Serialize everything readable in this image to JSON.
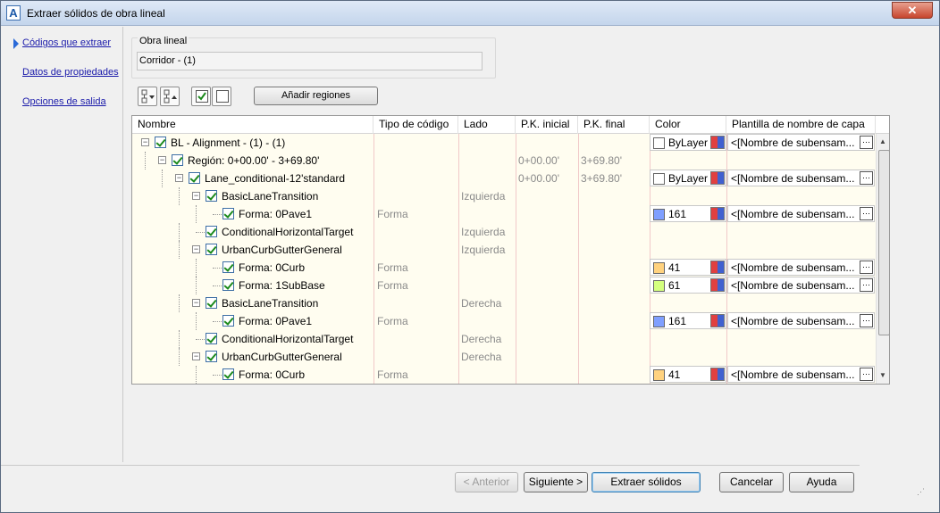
{
  "window": {
    "title": "Extraer sólidos de obra lineal",
    "close_label": "✕"
  },
  "nav": {
    "items": [
      {
        "label": "Códigos que extraer",
        "active": true
      },
      {
        "label": "Datos de propiedades",
        "active": false
      },
      {
        "label": "Opciones de salida",
        "active": false
      }
    ]
  },
  "corridor": {
    "group_label": "Obra lineal",
    "value": "Corridor - (1)"
  },
  "toolbar": {
    "add_regions_label": "Añadir regiones"
  },
  "tree": {
    "columns": [
      "Nombre",
      "Tipo de código",
      "Lado",
      "P.K. inicial",
      "P.K. final",
      "Color",
      "Plantilla de nombre de capa"
    ],
    "rows": [
      {
        "name": "BL - Alignment - (1) - (1)",
        "code_type": "",
        "side": "",
        "start": "",
        "end": "",
        "color": "ByLayer",
        "swatch": "#ffffff",
        "template": "<[Nombre de subensam..."
      },
      {
        "name": "Región: 0+00.00' - 3+69.80'",
        "code_type": "",
        "side": "",
        "start": "0+00.00'",
        "end": "3+69.80'",
        "color": "",
        "swatch": "",
        "template": ""
      },
      {
        "name": "Lane_conditional-12'standard",
        "code_type": "",
        "side": "",
        "start": "0+00.00'",
        "end": "3+69.80'",
        "color": "ByLayer",
        "swatch": "#ffffff",
        "template": "<[Nombre de subensam..."
      },
      {
        "name": "BasicLaneTransition",
        "code_type": "",
        "side": "Izquierda",
        "start": "",
        "end": "",
        "color": "",
        "swatch": "",
        "template": ""
      },
      {
        "name": "Forma: 0Pave1",
        "code_type": "Forma",
        "side": "",
        "start": "",
        "end": "",
        "color": "161",
        "swatch": "#7f9fff",
        "template": "<[Nombre de subensam..."
      },
      {
        "name": "ConditionalHorizontalTarget",
        "code_type": "",
        "side": "Izquierda",
        "start": "",
        "end": "",
        "color": "",
        "swatch": "",
        "template": ""
      },
      {
        "name": "UrbanCurbGutterGeneral",
        "code_type": "",
        "side": "Izquierda",
        "start": "",
        "end": "",
        "color": "",
        "swatch": "",
        "template": ""
      },
      {
        "name": "Forma: 0Curb",
        "code_type": "Forma",
        "side": "",
        "start": "",
        "end": "",
        "color": "41",
        "swatch": "#ffd27f",
        "template": "<[Nombre de subensam..."
      },
      {
        "name": "Forma: 1SubBase",
        "code_type": "Forma",
        "side": "",
        "start": "",
        "end": "",
        "color": "61",
        "swatch": "#d4ff7f",
        "template": "<[Nombre de subensam..."
      },
      {
        "name": "BasicLaneTransition",
        "code_type": "",
        "side": "Derecha",
        "start": "",
        "end": "",
        "color": "",
        "swatch": "",
        "template": ""
      },
      {
        "name": "Forma: 0Pave1",
        "code_type": "Forma",
        "side": "",
        "start": "",
        "end": "",
        "color": "161",
        "swatch": "#7f9fff",
        "template": "<[Nombre de subensam..."
      },
      {
        "name": "ConditionalHorizontalTarget",
        "code_type": "",
        "side": "Derecha",
        "start": "",
        "end": "",
        "color": "",
        "swatch": "",
        "template": ""
      },
      {
        "name": "UrbanCurbGutterGeneral",
        "code_type": "",
        "side": "Derecha",
        "start": "",
        "end": "",
        "color": "",
        "swatch": "",
        "template": ""
      },
      {
        "name": "Forma: 0Curb",
        "code_type": "Forma",
        "side": "",
        "start": "",
        "end": "",
        "color": "41",
        "swatch": "#ffd27f",
        "template": "<[Nombre de subensam..."
      }
    ]
  },
  "footer": {
    "back_label": "< Anterior",
    "next_label": "Siguiente >",
    "extract_label": "Extraer sólidos",
    "cancel_label": "Cancelar",
    "help_label": "Ayuda"
  }
}
